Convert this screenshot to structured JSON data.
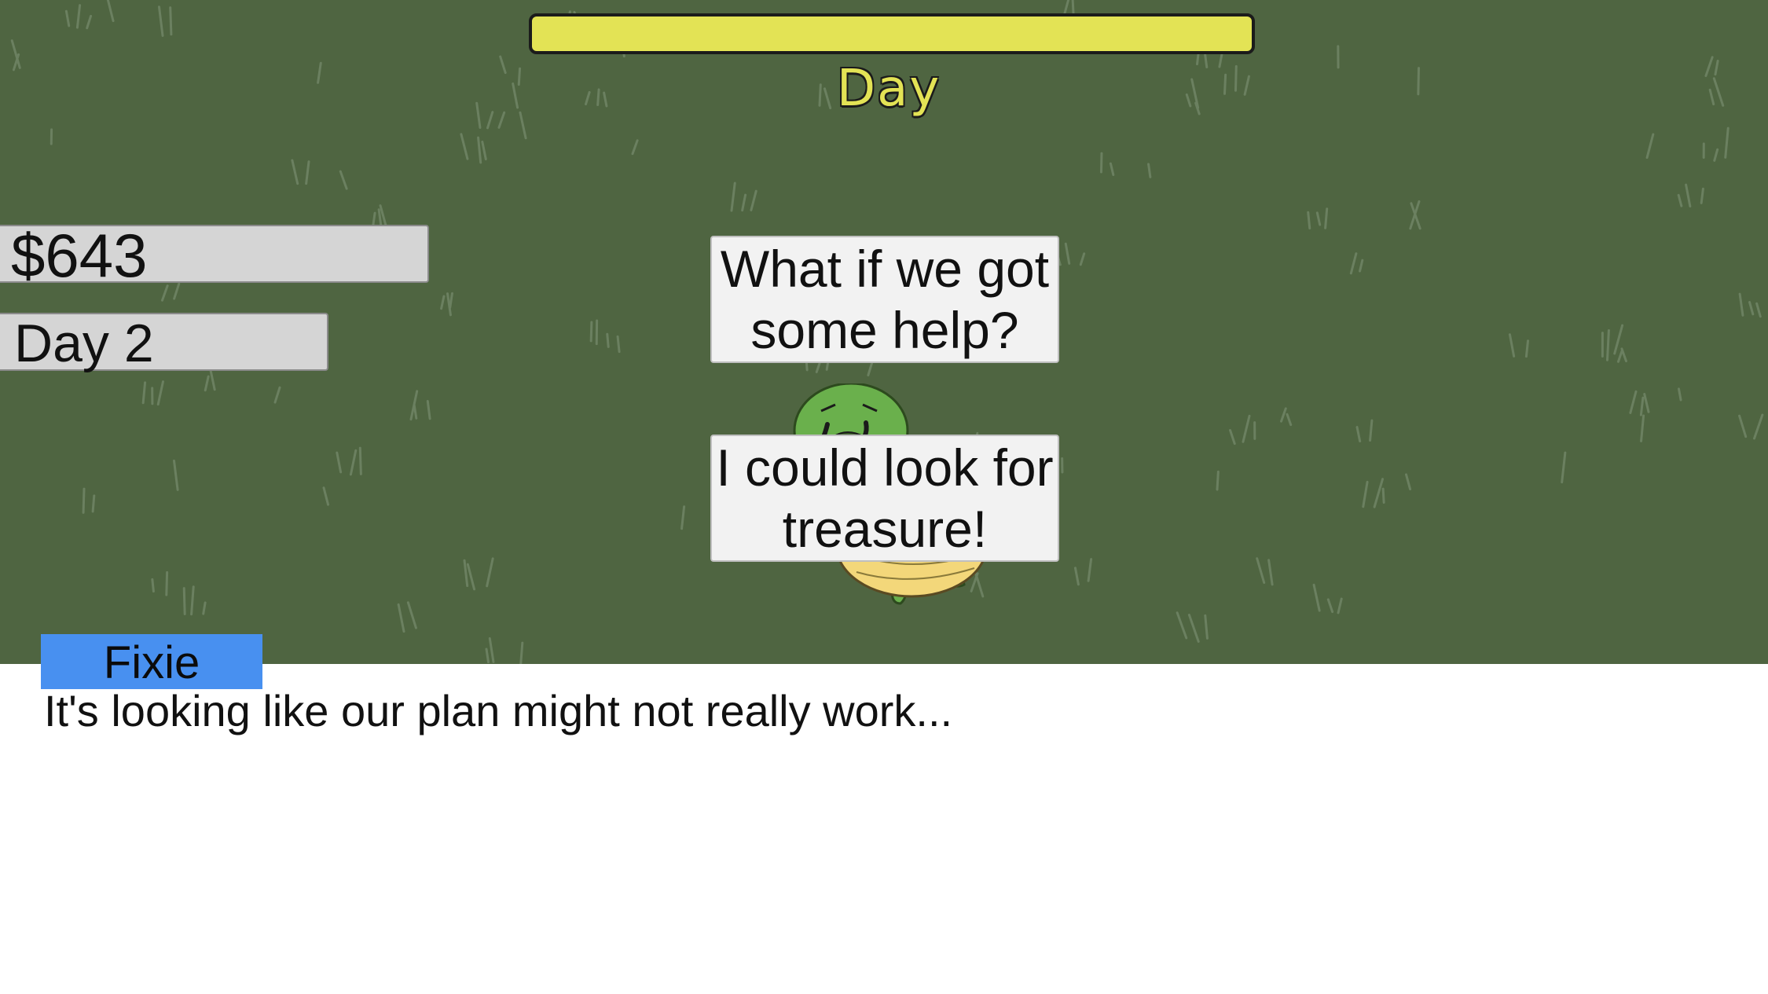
{
  "hud": {
    "phase_label": "Day",
    "phase_progress": 1.0,
    "phase_bar_color": "#e3e355",
    "money": "$643",
    "day_count": "Day 2"
  },
  "choices": [
    {
      "label": "What if we got\nsome help?"
    },
    {
      "label": "I could look for\ntreasure!"
    }
  ],
  "character": {
    "icon": "turtle-icon",
    "expression": "worried"
  },
  "dialogue": {
    "speaker": "Fixie",
    "speaker_color": "#4890f0",
    "text": "It's looking like our plan might not really work..."
  },
  "colors": {
    "grass_background": "#4f6541",
    "dialogue_background": "#ffffff"
  }
}
